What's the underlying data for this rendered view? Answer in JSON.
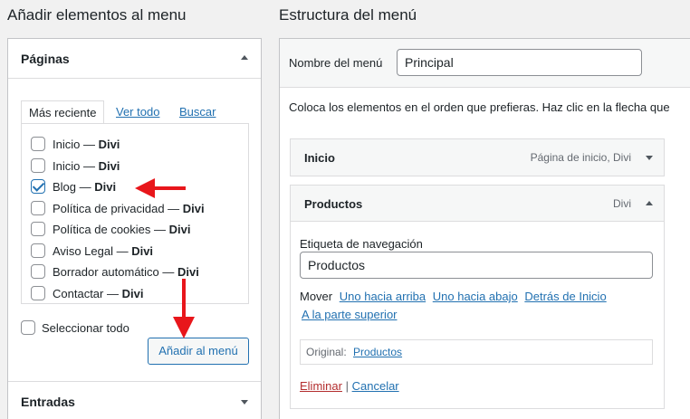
{
  "left": {
    "title": "Añadir elementos al menu",
    "pages_section": {
      "label": "Páginas"
    },
    "tabs": [
      "Más reciente",
      "Ver todo",
      "Buscar"
    ],
    "pages": [
      {
        "name": "Inicio — ",
        "bold": "Divi",
        "checked": false
      },
      {
        "name": "Inicio — ",
        "bold": "Divi",
        "checked": false
      },
      {
        "name": "Blog — ",
        "bold": "Divi",
        "checked": true
      },
      {
        "name": "Política de privacidad — ",
        "bold": "Divi",
        "checked": false
      },
      {
        "name": "Política de cookies — ",
        "bold": "Divi",
        "checked": false
      },
      {
        "name": "Aviso Legal — ",
        "bold": "Divi",
        "checked": false
      },
      {
        "name": "Borrador automático — ",
        "bold": "Divi",
        "checked": false
      },
      {
        "name": "Contactar — ",
        "bold": "Divi",
        "checked": false
      }
    ],
    "select_all": "Seleccionar todo",
    "add_button": "Añadir al menú",
    "entries_section": {
      "label": "Entradas"
    }
  },
  "right": {
    "title": "Estructura del menú",
    "menu_name_label": "Nombre del menú",
    "menu_name_value": "Principal",
    "instructions": "Coloca los elementos en el orden que prefieras. Haz clic en la flecha que",
    "items": [
      {
        "title": "Inicio",
        "type": "Página de inicio, Divi"
      },
      {
        "title": "Productos",
        "type": "Divi"
      }
    ],
    "expanded": {
      "nav_label": "Etiqueta de navegación",
      "nav_value": "Productos",
      "move_label": "Mover",
      "move_links": [
        "Uno hacia arriba",
        "Uno hacia abajo",
        "Detrás de Inicio",
        "A la parte superior"
      ],
      "original_label": "Original:",
      "original_link": "Productos",
      "delete": "Eliminar",
      "separator": "|",
      "cancel": "Cancelar"
    }
  },
  "colors": {
    "accent": "#2271b1",
    "delete": "#b32d2e",
    "arrow": "#e8161b"
  }
}
